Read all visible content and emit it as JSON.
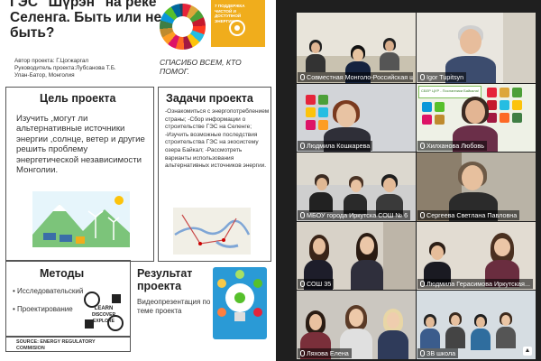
{
  "slide": {
    "title": "ГЭС \"Шүрэн\" на реке Селенга. Быть или не быть?",
    "author_line1": "Автор проекта: Г.Цогжаргал",
    "author_line2": "Руководитель проекта:Лубсанова Т.Б.",
    "author_line3": "Улан-Батор, Монголия",
    "thanks": "СПАСИБО ВСЕМ, КТО ПОМОГ.",
    "badge_text": "7 ПОДДЕРЖКА ЧИСТОЙ И ДОСТУПНОЙ ЭНЕРГИИ",
    "goal_title": "Цель проекта",
    "goal_body": "Изучить ,могут ли альтернативные источники энергии ,солнце, ветер и другие решить проблему энергетической независимости Монголии.",
    "tasks_title": "Задачи проекта",
    "tasks_body": "-Ознакомиться с энергопотреблением страны; -Сбор информации о строительстве ГЭС на Селенге; -Изучить возможные последствия строительства ГЭС на экосистему озера Байкал; -Рассмотреть варианты использования альтернативных источников энергии.",
    "methods_title": "Методы",
    "method_1": "Исследовательский",
    "method_2": "Проектирование",
    "learn_text": "LEARN DISCOVER EXPLORE",
    "result_title": "Результат проекта",
    "result_body": "Видеопрезентация по теме проекта",
    "source": "SOURCE: ENERGY REGULATORY COMMISION"
  },
  "participants": [
    {
      "label": "Совместная Монголо-Российская ш...",
      "active": true
    },
    {
      "label": "Igor Tupitsyn",
      "active": false
    },
    {
      "label": "Людмила Кошкарева",
      "active": false
    },
    {
      "label": "Хилханова Любовь",
      "active": false
    },
    {
      "label": "МБОУ города Иркутска СОШ № 6",
      "active": false
    },
    {
      "label": "Сергеева Светлана Павловна",
      "active": false
    },
    {
      "label": "СОШ 35",
      "active": false
    },
    {
      "label": "Людмила Герасимова Иркутская...",
      "active": false
    },
    {
      "label": "Ляхова Елена",
      "active": false
    },
    {
      "label": "ЗВ школа",
      "active": false
    }
  ],
  "tile_texts": {
    "sber_card": "СБЕР ЦУР - Посланники Байкала!"
  },
  "colors": {
    "active_border": "#ffcc00",
    "label_bg": "#000000",
    "slide_bg": "#ffffff",
    "energy_badge": "#f0ad1c"
  }
}
